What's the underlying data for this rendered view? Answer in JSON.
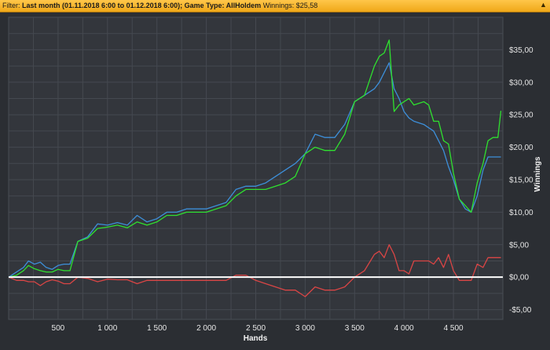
{
  "filter": {
    "label": "Filter:",
    "period": "Last month (01.11.2018 6:00 to 01.12.2018 6:00);",
    "game_type": "Game Type: AllHoldem",
    "winnings": "Winnings: $25,58",
    "collapse_icon": "chevron-up-icon"
  },
  "chart_data": {
    "type": "line",
    "xlabel": "Hands",
    "ylabel": "Winnings",
    "xlim": [
      0,
      5000
    ],
    "ylim": [
      -6.5,
      40
    ],
    "x_ticks": [
      500,
      1000,
      1500,
      2000,
      2500,
      3000,
      3500,
      4000,
      4500
    ],
    "x_tick_labels": [
      "500",
      "1 000",
      "1 500",
      "2 000",
      "2 500",
      "3 000",
      "3 500",
      "4 000",
      "4 500"
    ],
    "y_ticks": [
      -5,
      0,
      5,
      10,
      15,
      20,
      25,
      30,
      35
    ],
    "y_tick_labels": [
      "-$5,00",
      "$0,00",
      "$5,00",
      "$10,00",
      "$15,00",
      "$20,00",
      "$25,00",
      "$30,00",
      "$35,00"
    ],
    "y_axis_side": "right",
    "grid": true,
    "zero_line": true,
    "series": [
      {
        "color": "#3d8fd9",
        "x": [
          0,
          80,
          150,
          200,
          260,
          320,
          380,
          440,
          500,
          560,
          620,
          700,
          800,
          900,
          1000,
          1100,
          1200,
          1300,
          1400,
          1500,
          1600,
          1700,
          1800,
          1900,
          2000,
          2100,
          2200,
          2300,
          2400,
          2500,
          2600,
          2700,
          2800,
          2900,
          3000,
          3100,
          3200,
          3300,
          3400,
          3500,
          3600,
          3700,
          3750,
          3800,
          3850,
          3900,
          3950,
          4000,
          4050,
          4100,
          4200,
          4250,
          4300,
          4350,
          4400,
          4450,
          4500,
          4560,
          4620,
          4680,
          4740,
          4800,
          4850,
          4900,
          4950,
          4980
        ],
        "values": [
          0,
          0.8,
          1.5,
          2.5,
          2.0,
          2.3,
          1.5,
          1.2,
          1.8,
          2.0,
          2.0,
          5.5,
          6.2,
          8.2,
          8.0,
          8.4,
          8.0,
          9.5,
          8.5,
          9.0,
          10.0,
          10.0,
          10.5,
          10.5,
          10.5,
          11.0,
          11.5,
          13.5,
          14.0,
          14.0,
          14.5,
          15.5,
          16.5,
          17.5,
          19.0,
          22.0,
          21.5,
          21.5,
          23.5,
          27.0,
          28.0,
          29.0,
          30.0,
          31.5,
          33.0,
          29.0,
          27.5,
          25.5,
          24.5,
          24.0,
          23.5,
          23.0,
          22.5,
          21.0,
          19.5,
          17.0,
          15.0,
          12.0,
          10.5,
          10.0,
          12.5,
          16.5,
          18.5,
          18.5,
          18.5,
          18.5
        ]
      },
      {
        "color": "#2fe02f",
        "x": [
          0,
          80,
          150,
          200,
          260,
          320,
          380,
          440,
          500,
          560,
          620,
          700,
          800,
          900,
          1000,
          1100,
          1200,
          1300,
          1400,
          1500,
          1600,
          1700,
          1800,
          1900,
          2000,
          2100,
          2200,
          2300,
          2400,
          2500,
          2600,
          2700,
          2800,
          2900,
          3000,
          3100,
          3200,
          3300,
          3400,
          3500,
          3600,
          3700,
          3750,
          3800,
          3850,
          3900,
          3950,
          4000,
          4050,
          4100,
          4200,
          4250,
          4300,
          4350,
          4400,
          4450,
          4500,
          4560,
          4620,
          4680,
          4740,
          4800,
          4850,
          4900,
          4950,
          4980
        ],
        "values": [
          0,
          0.3,
          1.0,
          1.8,
          1.3,
          1.0,
          0.8,
          0.8,
          1.2,
          1.0,
          1.0,
          5.5,
          6.0,
          7.5,
          7.7,
          8.0,
          7.6,
          8.5,
          8.0,
          8.5,
          9.5,
          9.5,
          10.0,
          10.0,
          10.0,
          10.5,
          11.0,
          12.5,
          13.5,
          13.5,
          13.5,
          14.0,
          14.5,
          15.5,
          19.0,
          20.0,
          19.5,
          19.5,
          22.0,
          27.0,
          28.0,
          32.5,
          34.0,
          34.5,
          36.5,
          25.5,
          26.5,
          27.0,
          27.5,
          26.5,
          27.0,
          26.5,
          24.0,
          24.0,
          21.0,
          20.5,
          16.0,
          12.0,
          11.0,
          10.0,
          14.5,
          17.5,
          21.0,
          21.5,
          21.5,
          25.6
        ]
      },
      {
        "color": "#d94545",
        "x": [
          0,
          80,
          150,
          200,
          260,
          320,
          380,
          440,
          500,
          560,
          620,
          700,
          800,
          900,
          1000,
          1100,
          1200,
          1300,
          1400,
          1500,
          1600,
          1700,
          1800,
          1900,
          2000,
          2100,
          2200,
          2300,
          2400,
          2500,
          2600,
          2700,
          2800,
          2900,
          3000,
          3100,
          3200,
          3300,
          3400,
          3500,
          3600,
          3700,
          3750,
          3800,
          3850,
          3900,
          3950,
          4000,
          4050,
          4100,
          4200,
          4250,
          4300,
          4350,
          4400,
          4450,
          4500,
          4560,
          4620,
          4680,
          4740,
          4800,
          4850,
          4900,
          4950,
          4980
        ],
        "values": [
          0,
          -0.5,
          -0.5,
          -0.7,
          -0.7,
          -1.3,
          -0.7,
          -0.4,
          -0.6,
          -1.0,
          -1.0,
          0,
          -0.2,
          -0.7,
          -0.3,
          -0.4,
          -0.4,
          -1.0,
          -0.5,
          -0.5,
          -0.5,
          -0.5,
          -0.5,
          -0.5,
          -0.5,
          -0.5,
          -0.5,
          0.3,
          0.3,
          -0.5,
          -1.0,
          -1.5,
          -2.0,
          -2.0,
          -3.0,
          -1.5,
          -2.0,
          -2.0,
          -1.5,
          0,
          1.0,
          3.5,
          4.0,
          3.0,
          5.0,
          3.5,
          1.0,
          1.0,
          0.5,
          2.5,
          2.5,
          2.5,
          2.0,
          3.0,
          1.5,
          3.5,
          1.0,
          -0.5,
          -0.5,
          -0.5,
          2.0,
          1.5,
          3.0,
          3.0,
          3.0,
          3.0
        ]
      }
    ]
  }
}
